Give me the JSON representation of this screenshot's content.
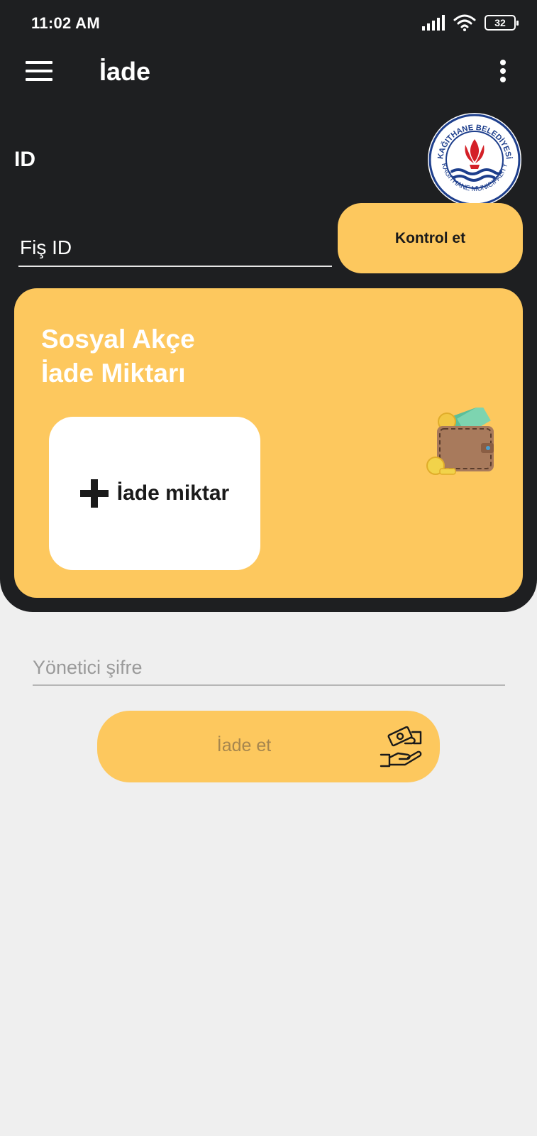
{
  "status_bar": {
    "time": "11:02 AM",
    "battery": "32",
    "icons": [
      "signal-icon",
      "wifi-icon",
      "battery-icon"
    ]
  },
  "app_bar": {
    "title": "İade",
    "left_icon": "menu-icon",
    "right_icon": "more-vert-icon"
  },
  "id_section": {
    "label": "ID",
    "logo_text": [
      "KAĞITHANE BELEDİYESİ",
      "KAĞITHANE MUNICIPALITY"
    ],
    "fis_placeholder": "Fiş ID",
    "kontrol_label": "Kontrol et"
  },
  "card": {
    "title_line1": "Sosyal Akçe",
    "title_line2": "İade Miktarı",
    "amount_label": "İade miktar",
    "icons": [
      "plus-icon",
      "wallet-icon"
    ]
  },
  "bottom": {
    "password_placeholder": "Yönetici şifre",
    "submit_label": "İade et",
    "submit_icon": "money-hands-icon"
  },
  "colors": {
    "dark": "#1e1f21",
    "accent": "#fdc85e",
    "background": "#efefef",
    "logo_red": "#d42027",
    "logo_blue": "#1d3e8c"
  }
}
